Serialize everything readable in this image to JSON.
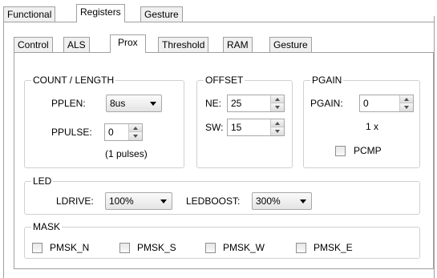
{
  "outer_tabs": [
    "Functional",
    "Registers",
    "Gesture"
  ],
  "inner_tabs": [
    "Control",
    "ALS",
    "Prox",
    "Threshold",
    "RAM",
    "Gesture"
  ],
  "count_length": {
    "title": "COUNT / LENGTH",
    "pplen_label": "PPLEN:",
    "pplen_value": "8us",
    "ppulse_label": "PPULSE:",
    "ppulse_value": "0",
    "ppulse_note": "(1 pulses)"
  },
  "offset": {
    "title": "OFFSET",
    "ne_label": "NE:",
    "ne_value": "25",
    "sw_label": "SW:",
    "sw_value": "15"
  },
  "pgain": {
    "title": "PGAIN",
    "pgain_label": "PGAIN:",
    "pgain_value": "0",
    "multiplier": "1 x",
    "pcmp_label": "PCMP"
  },
  "led": {
    "title": "LED",
    "ldrive_label": "LDRIVE:",
    "ldrive_value": "100%",
    "ledboost_label": "LEDBOOST:",
    "ledboost_value": "300%"
  },
  "mask": {
    "title": "MASK",
    "items": [
      "PMSK_N",
      "PMSK_S",
      "PMSK_W",
      "PMSK_E"
    ]
  },
  "colors": {
    "border": "#a0a0a0",
    "group_border": "#d0d0d0"
  }
}
